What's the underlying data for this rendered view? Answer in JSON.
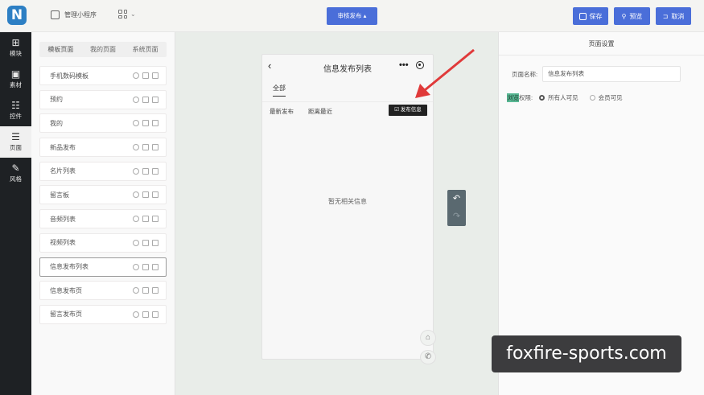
{
  "header": {
    "logo_letter": "N",
    "app_name": "管理小程序",
    "app_switch_caret": "⌄",
    "publish_label": "审核发布 ▴",
    "save_label": "保存",
    "preview_label": "预览",
    "cancel_label": "取消"
  },
  "leftnav": {
    "items": [
      {
        "icon": "plus-square-icon",
        "glyph": "⊞",
        "label": "模块"
      },
      {
        "icon": "image-icon",
        "glyph": "▣",
        "label": "素材"
      },
      {
        "icon": "sliders-icon",
        "glyph": "☷",
        "label": "控件"
      },
      {
        "icon": "pages-icon",
        "glyph": "☰",
        "label": "页面"
      },
      {
        "icon": "brush-icon",
        "glyph": "✎",
        "label": "风格"
      }
    ]
  },
  "page_panel": {
    "tabs": [
      "模板页面",
      "我的页面",
      "系统页面"
    ],
    "pages": [
      "手机数码模板",
      "预约",
      "我的",
      "新品发布",
      "名片列表",
      "留言板",
      "音频列表",
      "视频列表",
      "信息发布列表",
      "信息发布页",
      "留言发布页"
    ]
  },
  "phone": {
    "back": "‹",
    "title": "信息发布列表",
    "more": "•••",
    "tab": "全部",
    "filter_latest": "最新发布",
    "filter_nearest": "距离最近",
    "publish_button": "☑ 发布信息",
    "empty_text": "暂无相关信息",
    "home_glyph": "⌂",
    "phone_glyph": "✆"
  },
  "history": {
    "undo": "↶",
    "redo": "↷"
  },
  "settings": {
    "title": "页面设置",
    "name_label": "页面名称:",
    "name_value": "信息发布列表",
    "access_label_hl": "浏览",
    "access_label_rest": "权限:",
    "options": [
      "所有人可见",
      "会员可见"
    ]
  },
  "watermark": "foxfire-sports.com",
  "colors": {
    "primary": "#4a6ed9",
    "nav_dark": "#1e2124",
    "annotation_arrow": "#e03a3a"
  }
}
